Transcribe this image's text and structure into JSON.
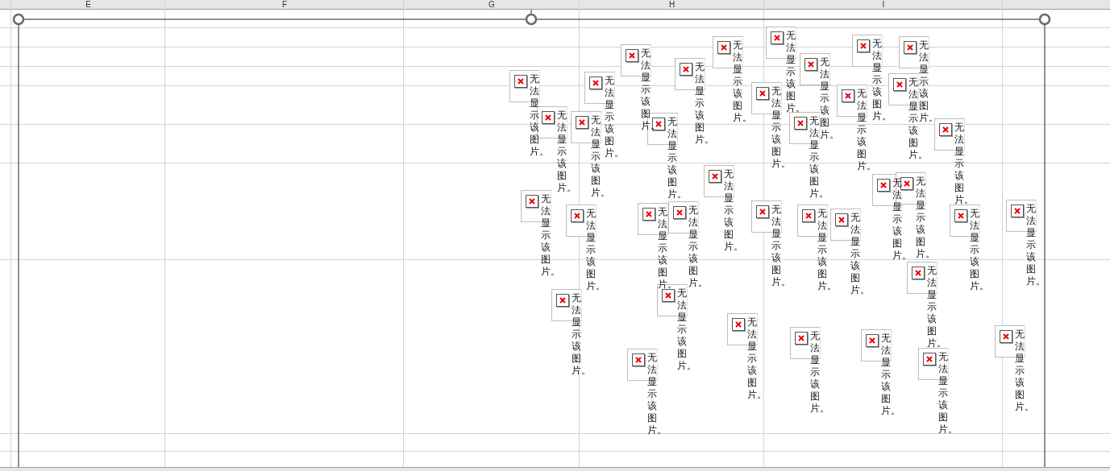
{
  "column_headers": [
    "E",
    "F",
    "G",
    "H",
    "I"
  ],
  "placeholders": [
    {
      "text": "无法显示该图片。"
    },
    {
      "text": "无法显示该图片。"
    },
    {
      "text": "无法显示该图片。"
    },
    {
      "text": "无法显示该图片。"
    },
    {
      "text": "无法显示该图片。"
    },
    {
      "text": "无法显示该图片。"
    },
    {
      "text": "无法显示该图片。"
    },
    {
      "text": "无法显示该图片。"
    },
    {
      "text": "无法显示该图片。"
    },
    {
      "text": "无法显示该图片。"
    },
    {
      "text": "无法显示该图片。"
    },
    {
      "text": "无法显示该图片。"
    },
    {
      "text": "无法显示该图片。"
    },
    {
      "text": "无法显示该图片。"
    },
    {
      "text": "无法显示该图片。"
    },
    {
      "text": "无法显示该图片。"
    },
    {
      "text": "无法显示该图片。"
    },
    {
      "text": "无法显示该图片。"
    },
    {
      "text": "无法显示该图片。"
    },
    {
      "text": "无法显示该图片。"
    },
    {
      "text": "无法显示该图片。"
    },
    {
      "text": "无法显示该图片。"
    },
    {
      "text": "无法显示该图片。"
    },
    {
      "text": "无法显示该图片。"
    },
    {
      "text": "无法显示该图片。"
    },
    {
      "text": "无法显示该图片。"
    },
    {
      "text": "无法显示该图片。"
    },
    {
      "text": "无法显示该图片。"
    },
    {
      "text": "无法显示该图片。"
    },
    {
      "text": "无法显示该图片。"
    },
    {
      "text": "无法显示该图片。"
    },
    {
      "text": "无法显示该图片。"
    },
    {
      "text": "无法显示该图片。"
    },
    {
      "text": "无法显示该图片。"
    },
    {
      "text": "无法显示该图片。"
    },
    {
      "text": "无法显示该图片。"
    },
    {
      "text": "无法显示该图片。"
    },
    {
      "text": "无法显示该图片。"
    }
  ]
}
